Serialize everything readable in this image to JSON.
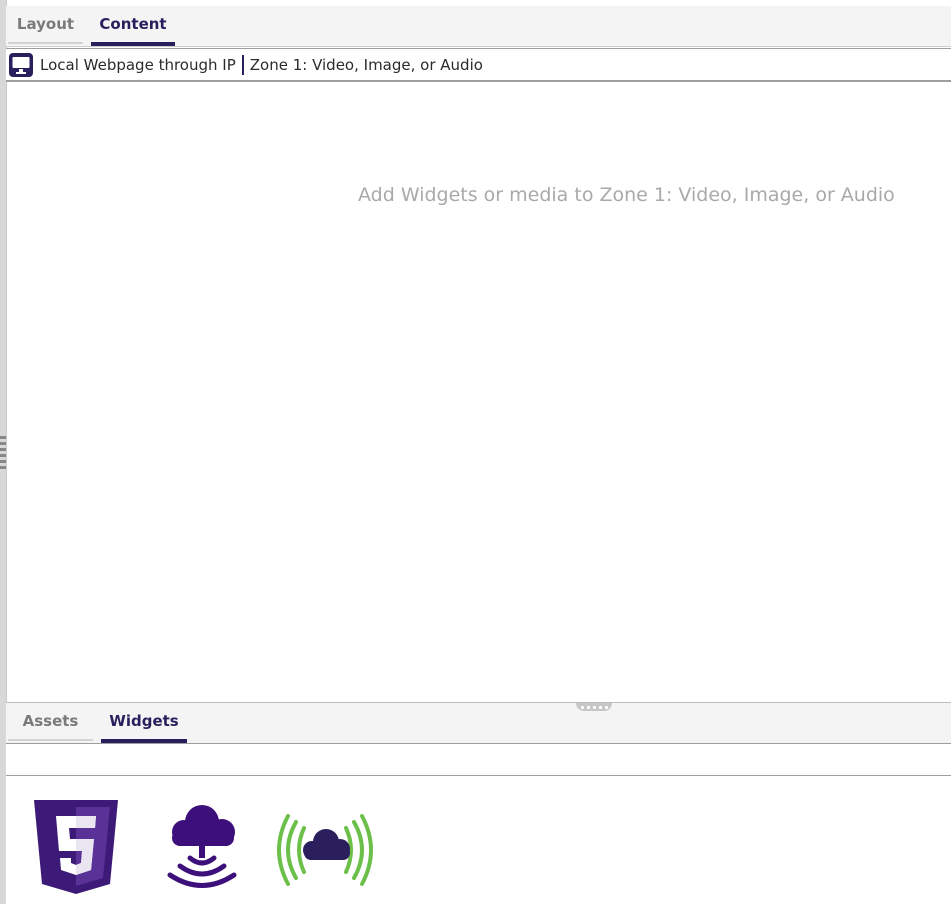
{
  "top_tabs": [
    {
      "label": "Layout",
      "active": false
    },
    {
      "label": "Content",
      "active": true
    }
  ],
  "zone_header": {
    "icon": "monitor-icon",
    "presentation_name": "Local Webpage through IP",
    "zone_name": "Zone 1: Video, Image, or Audio"
  },
  "main": {
    "placeholder": "Add Widgets or media to Zone 1: Video, Image, or Audio"
  },
  "bottom_tabs": [
    {
      "label": "Assets",
      "active": false
    },
    {
      "label": "Widgets",
      "active": true
    }
  ],
  "widgets": [
    {
      "icon": "html5-icon"
    },
    {
      "icon": "cloud-broadcast-icon"
    },
    {
      "icon": "cloud-signal-icon"
    }
  ],
  "colors": {
    "accent": "#2a1f5c",
    "html5_purple": "#3d1a78",
    "signal_green": "#6cc04a",
    "placeholder_text": "#a9a9a9"
  }
}
